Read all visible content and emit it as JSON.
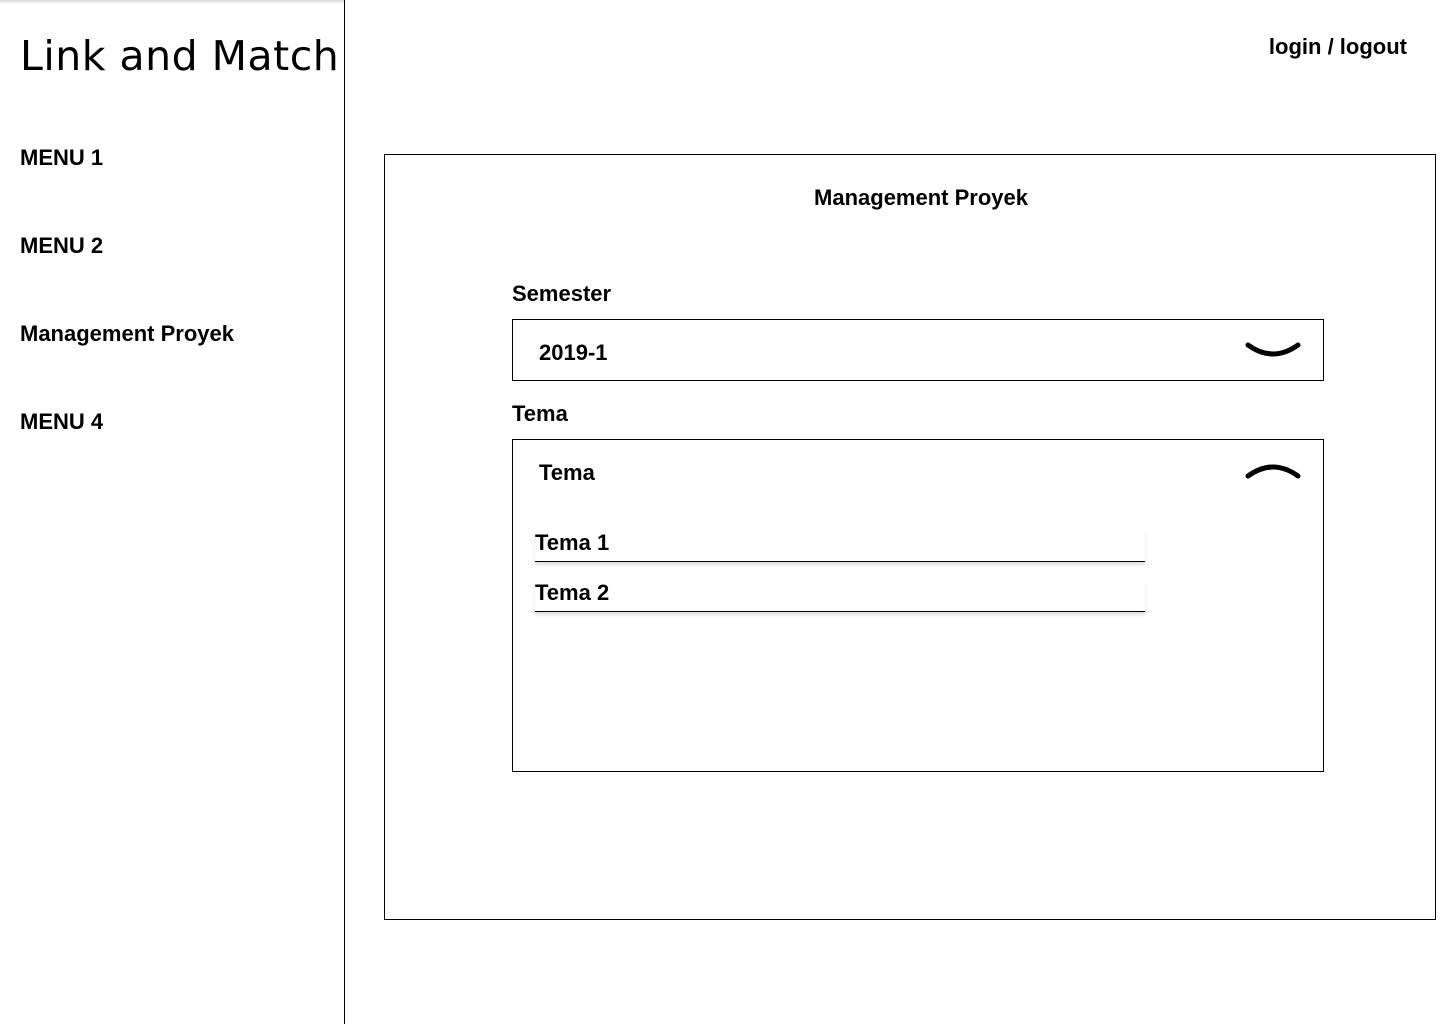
{
  "sidebar": {
    "brand": "Link and Match",
    "items": [
      {
        "label": "MENU 1"
      },
      {
        "label": "MENU 2"
      },
      {
        "label": "Management Proyek"
      },
      {
        "label": "MENU 4"
      }
    ]
  },
  "header": {
    "auth_link": "login / logout"
  },
  "panel": {
    "title": "Management Proyek",
    "semester": {
      "label": "Semester",
      "selected": "2019-1",
      "icon": "chevron-down-icon"
    },
    "tema": {
      "label": "Tema",
      "selected": "Tema",
      "icon": "chevron-up-icon",
      "options": [
        {
          "label": "Tema 1"
        },
        {
          "label": "Tema 2"
        }
      ]
    }
  }
}
